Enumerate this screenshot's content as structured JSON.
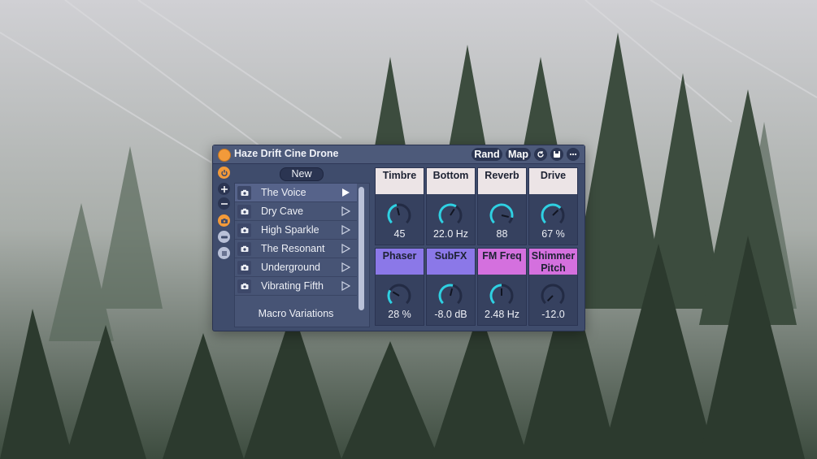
{
  "device": {
    "title": "Haze Drift Cine Drone",
    "rand_label": "Rand",
    "map_label": "Map",
    "accent": "#f29a3a"
  },
  "presets": {
    "new_label": "New",
    "footer": "Macro Variations",
    "items": [
      {
        "label": "The Voice",
        "selected": true
      },
      {
        "label": "Dry Cave",
        "selected": false
      },
      {
        "label": "High Sparkle",
        "selected": false
      },
      {
        "label": "The Resonant",
        "selected": false
      },
      {
        "label": "Underground",
        "selected": false
      },
      {
        "label": "Vibrating Fifth",
        "selected": false
      }
    ]
  },
  "macros": [
    {
      "name": "Timbre",
      "value": "45",
      "color": "#ece4e6",
      "level": 0.45
    },
    {
      "name": "Bottom",
      "value": "22.0 Hz",
      "color": "#ece4e6",
      "level": 0.62
    },
    {
      "name": "Reverb",
      "value": "88",
      "color": "#ece4e6",
      "level": 0.88
    },
    {
      "name": "Drive",
      "value": "67 %",
      "color": "#ece4e6",
      "level": 0.67
    },
    {
      "name": "Phaser",
      "value": "28 %",
      "color": "#8b78e8",
      "level": 0.28
    },
    {
      "name": "SubFX",
      "value": "-8.0 dB",
      "color": "#8b78e8",
      "level": 0.55
    },
    {
      "name": "FM Freq",
      "value": "2.48 Hz",
      "color": "#d470de",
      "level": 0.5
    },
    {
      "name": "Shimmer Pitch",
      "value": "-12.0",
      "color": "#d470de",
      "level": 0.0
    }
  ],
  "icons": {
    "power": "power-icon",
    "add": "plus-icon",
    "remove": "minus-icon",
    "camera": "camera-icon",
    "collapse": "collapse-icon",
    "list": "list-icon",
    "save": "save-icon",
    "more": "more-icon",
    "refresh": "refresh-icon",
    "play": "play-icon"
  },
  "colors": {
    "knob_arc": "#2fd0e2",
    "panel": "#3f4c6c"
  }
}
